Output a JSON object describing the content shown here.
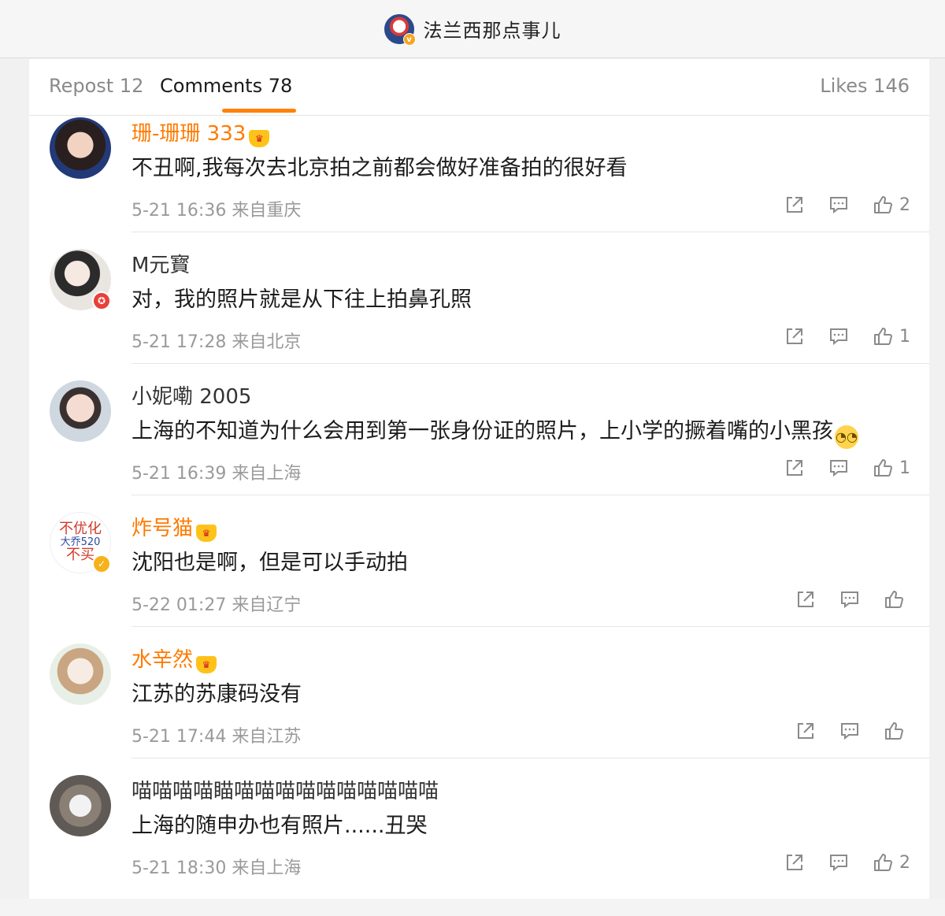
{
  "header": {
    "account_name": "法兰西那点事儿",
    "verified_badge": "v"
  },
  "tabs": {
    "repost": "Repost 12",
    "comments": "Comments 78",
    "likes": "Likes 146"
  },
  "colors": {
    "accent": "#ff8200",
    "vip_name": "#ff7a00"
  },
  "icons": [
    "share-icon",
    "reply-icon",
    "thumbs-up-icon"
  ],
  "comments": [
    {
      "username": "珊-珊珊 333",
      "vip": true,
      "text": "不丑啊,我每次去北京拍之前都会做好准备拍的很好看",
      "time": "5-21 16:36",
      "location": "来自重庆",
      "likes": "2"
    },
    {
      "username": "M元寳",
      "vip": false,
      "text": "对，我的照片就是从下往上拍鼻孔照",
      "time": "5-21 17:28",
      "location": "来自北京",
      "likes": "1"
    },
    {
      "username": "小妮嘞 2005",
      "vip": false,
      "text": "上海的不知道为什么会用到第一张身份证的照片，上小学的撅着嘴的小黑孩",
      "time": "5-21 16:39",
      "location": "来自上海",
      "likes": "1"
    },
    {
      "username": "炸号猫",
      "vip": true,
      "text": "沈阳也是啊，但是可以手动拍",
      "time": "5-22 01:27",
      "location": "来自辽宁",
      "likes": ""
    },
    {
      "username": "水辛然",
      "vip": true,
      "text": "江苏的苏康码没有",
      "time": "5-21 17:44",
      "location": "来自江苏",
      "likes": ""
    },
    {
      "username": "喵喵喵喵瞄喵喵喵喵喵喵喵喵喵喵",
      "vip": false,
      "text": "上海的随申办也有照片......丑哭",
      "time": "5-21 18:30",
      "location": "来自上海",
      "likes": "2"
    }
  ],
  "avatar_texts": {
    "c4_line1": "不优化",
    "c4_line2": "大乔520",
    "c4_line3": "不买"
  }
}
